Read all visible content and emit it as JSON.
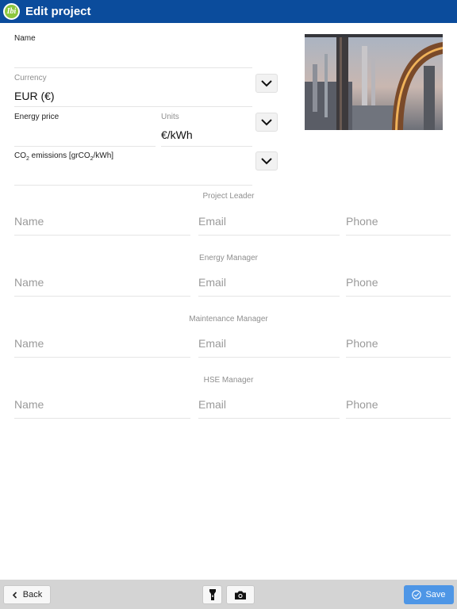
{
  "header": {
    "title": "Edit project",
    "logo_text": "Ibi"
  },
  "form": {
    "name_label": "Name",
    "currency_label": "Currency",
    "currency_value": "EUR  (€)",
    "energy_price_label": "Energy price",
    "units_label": "Units",
    "units_value": "€/kWh",
    "co2_label_pre": "CO",
    "co2_label_sub": "2",
    "co2_label_mid": " emissions [grCO",
    "co2_label_sub2": "2",
    "co2_label_post": "/kWh]"
  },
  "contacts": {
    "name_placeholder": "Name",
    "email_placeholder": "Email",
    "phone_placeholder": "Phone",
    "sections": [
      "Project Leader",
      "Energy Manager",
      "Maintenance Manager",
      "HSE Manager"
    ]
  },
  "footer": {
    "back_label": "Back",
    "save_label": "Save",
    "flashlight_icon": "flashlight-icon",
    "camera_icon": "camera-icon"
  },
  "colors": {
    "header": "#0b4c9c",
    "logo": "#8cc63f",
    "save_button": "#4e96e6"
  }
}
